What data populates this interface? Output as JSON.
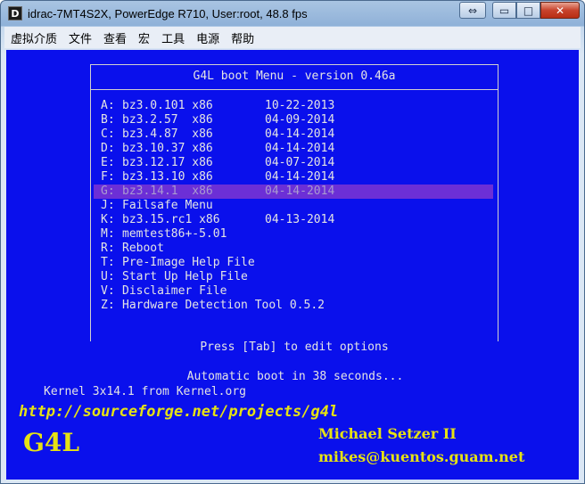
{
  "window": {
    "title": "idrac-7MT4S2X, PowerEdge R710, User:root, 48.8 fps",
    "app_icon_glyph": "D",
    "buttons": {
      "restore_glyph": "⇔",
      "minimize_glyph": "▭",
      "maximize_glyph": "□",
      "close_glyph": "✕"
    }
  },
  "menubar": {
    "items": [
      {
        "label": "虚拟介质"
      },
      {
        "label": "文件"
      },
      {
        "label": "查看"
      },
      {
        "label": "宏"
      },
      {
        "label": "工具"
      },
      {
        "label": "电源"
      },
      {
        "label": "帮助"
      }
    ]
  },
  "boot_menu": {
    "title": "G4L boot Menu - version 0.46a",
    "selected_key": "G:",
    "entries": [
      {
        "key": "A:",
        "name": "bz3.0.101 x86",
        "date": "10-22-2013"
      },
      {
        "key": "B:",
        "name": "bz3.2.57  x86",
        "date": "04-09-2014"
      },
      {
        "key": "C:",
        "name": "bz3.4.87  x86",
        "date": "04-14-2014"
      },
      {
        "key": "D:",
        "name": "bz3.10.37 x86",
        "date": "04-14-2014"
      },
      {
        "key": "E:",
        "name": "bz3.12.17 x86",
        "date": "04-07-2014"
      },
      {
        "key": "F:",
        "name": "bz3.13.10 x86",
        "date": "04-14-2014"
      },
      {
        "key": "G:",
        "name": "bz3.14.1  x86",
        "date": "04-14-2014"
      },
      {
        "key": "J:",
        "name": "Failsafe Menu",
        "date": ""
      },
      {
        "key": "K:",
        "name": "bz3.15.rc1 x86",
        "date": "04-13-2014"
      },
      {
        "key": "M:",
        "name": "memtest86+-5.01",
        "date": ""
      },
      {
        "key": "R:",
        "name": "Reboot",
        "date": ""
      },
      {
        "key": "T:",
        "name": "Pre-Image Help File",
        "date": ""
      },
      {
        "key": "U:",
        "name": "Start Up Help File",
        "date": ""
      },
      {
        "key": "V:",
        "name": "Disclaimer File",
        "date": ""
      },
      {
        "key": "Z:",
        "name": "Hardware Detection Tool 0.5.2",
        "date": ""
      }
    ],
    "tab_hint": "Press [Tab] to edit options",
    "countdown": "Automatic boot in 38 seconds...",
    "kernel_note": "Kernel 3x14.1 from Kernel.org"
  },
  "splash": {
    "url": "http://sourceforge.net/projects/g4l",
    "logo": "G4L",
    "author": "Michael Setzer II",
    "email": "mikes@kuentos.guam.net"
  },
  "colors": {
    "console_bg": "#0a10ec",
    "console_text": "#e4e4e4",
    "selection_bg": "#6c2fd6",
    "splash_text": "#e6e213"
  }
}
